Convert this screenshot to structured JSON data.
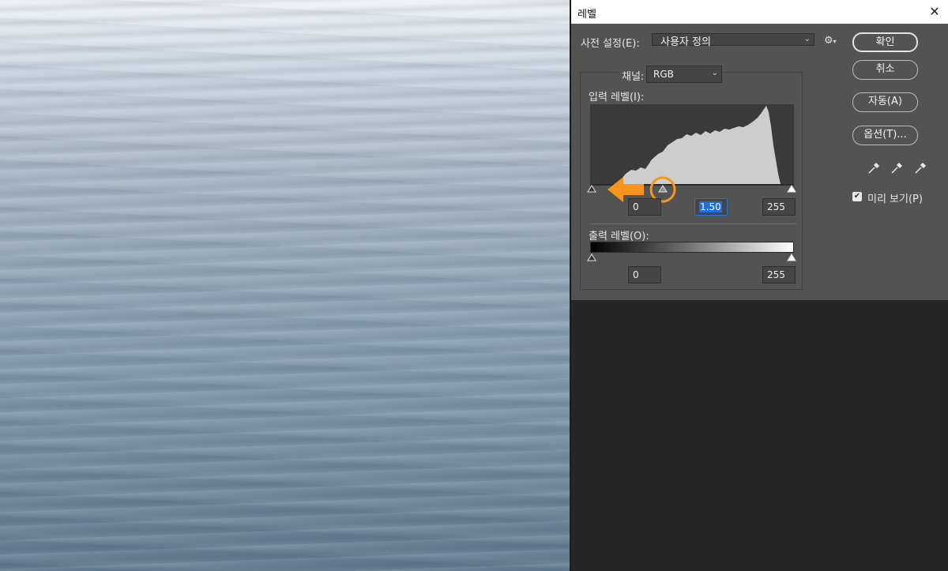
{
  "dialog": {
    "title": "레벨",
    "preset_label": "사전 설정(E):",
    "preset_value": "사용자 정의",
    "channel_label": "채널:",
    "channel_value": "RGB",
    "input_levels_label": "입력 레벨(I):",
    "output_levels_label": "출력 레벨(O):",
    "input_black": "0",
    "input_gamma": "1.50",
    "input_white": "255",
    "output_black": "0",
    "output_white": "255",
    "preview_label": "미리 보기(P)",
    "preview_checked": true
  },
  "buttons": {
    "ok": "확인",
    "cancel": "취소",
    "auto": "자동(A)",
    "options": "옵션(T)..."
  },
  "icons": {
    "close": "close-icon",
    "gear": "gear-icon",
    "eyedroppers": [
      "black-point-eyedropper-icon",
      "gray-point-eyedropper-icon",
      "white-point-eyedropper-icon"
    ]
  },
  "annotation": {
    "arrow_color": "#f7941d",
    "meaning": "drag gamma slider left"
  },
  "colors": {
    "dialog_bg": "#535353",
    "accent_selection": "#1f6fe0",
    "annotation": "#f7941d"
  }
}
